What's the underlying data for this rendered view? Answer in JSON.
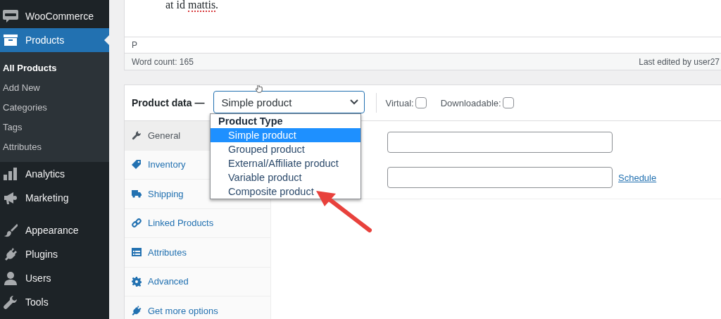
{
  "sidebar": {
    "sections": [
      [
        {
          "label": "WooCommerce",
          "kind": "woo",
          "selected": false
        },
        {
          "label": "Products",
          "kind": "box",
          "selected": true,
          "expanded": true,
          "children": [
            {
              "label": "All Products",
              "selected": true
            },
            {
              "label": "Add New",
              "selected": false
            },
            {
              "label": "Categories",
              "selected": false
            },
            {
              "label": "Tags",
              "selected": false
            },
            {
              "label": "Attributes",
              "selected": false
            }
          ]
        },
        {
          "label": "Analytics",
          "kind": "chart",
          "selected": false
        },
        {
          "label": "Marketing",
          "kind": "megaphone",
          "selected": false
        }
      ],
      [
        {
          "label": "Appearance",
          "kind": "brush",
          "selected": false
        },
        {
          "label": "Plugins",
          "kind": "plug",
          "selected": false
        },
        {
          "label": "Users",
          "kind": "user",
          "selected": false
        },
        {
          "label": "Tools",
          "kind": "wrench",
          "selected": false
        }
      ]
    ]
  },
  "editor": {
    "segments": [
      {
        "text": "at id ",
        "misspelled": false
      },
      {
        "text": "mattis",
        "misspelled": true
      },
      {
        "text": ".",
        "misspelled": false
      }
    ],
    "path": "P",
    "word_count": "Word count: 165",
    "last_edited": "Last edited by user27"
  },
  "product_data": {
    "label": "Product data —",
    "type_select": {
      "value": "Simple product",
      "open": true
    },
    "dropdown": {
      "group": "Product Type",
      "options": [
        {
          "label": "Simple product",
          "selected": true
        },
        {
          "label": "Grouped product",
          "selected": false
        },
        {
          "label": "External/Affiliate product",
          "selected": false
        },
        {
          "label": "Variable product",
          "selected": false
        },
        {
          "label": "Composite product",
          "selected": false
        }
      ]
    },
    "checkboxes": [
      {
        "label": "Virtual:",
        "checked": false
      },
      {
        "label": "Downloadable:",
        "checked": false
      }
    ],
    "tabs": [
      {
        "label": "General",
        "kind": "wrench",
        "selected": true
      },
      {
        "label": "Inventory",
        "kind": "tag",
        "selected": false
      },
      {
        "label": "Shipping",
        "kind": "truck",
        "selected": false
      },
      {
        "label": "Linked Products",
        "kind": "link",
        "selected": false
      },
      {
        "label": "Attributes",
        "kind": "list",
        "selected": false
      },
      {
        "label": "Advanced",
        "kind": "gear",
        "selected": false
      },
      {
        "label": "Get more options",
        "kind": "plug",
        "selected": false
      }
    ],
    "price_fields": [
      {
        "kind": "plain"
      },
      {
        "kind": "scheduled",
        "link": "Schedule"
      }
    ]
  }
}
